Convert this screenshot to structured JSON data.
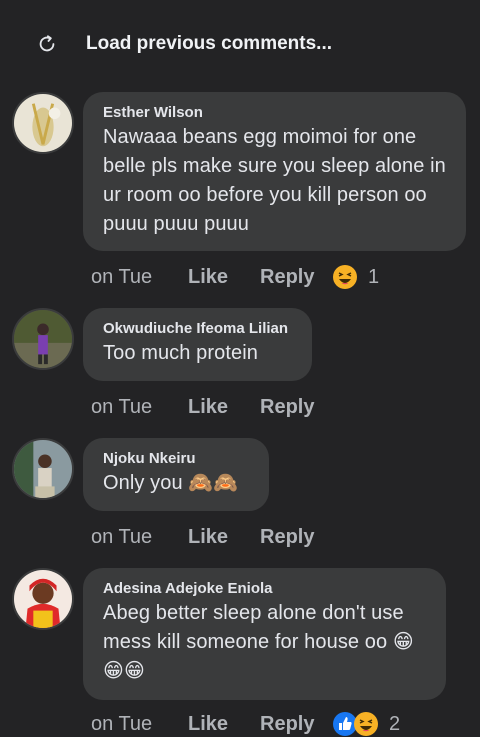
{
  "header": {
    "load_previous_label": "Load previous comments..."
  },
  "comments": [
    {
      "author": "Esther Wilson",
      "text": "Nawaaa beans egg moimoi for one belle pls make sure you sleep alone in ur room oo before you kill person oo puuu puuu puuu",
      "time": "on Tue",
      "like_label": "Like",
      "reply_label": "Reply",
      "reaction_count": "1",
      "reactions": [
        "haha-icon"
      ]
    },
    {
      "author": "Okwudiuche Ifeoma Lilian",
      "text": "Too much protein",
      "time": "on Tue",
      "like_label": "Like",
      "reply_label": "Reply"
    },
    {
      "author": "Njoku Nkeiru",
      "text": "Only you 🙈🙈",
      "time": "on Tue",
      "like_label": "Like",
      "reply_label": "Reply"
    },
    {
      "author": "Adesina Adejoke Eniola",
      "text": "Abeg better sleep alone don't use mess kill someone for house oo 😁😁😁",
      "time": "on Tue",
      "like_label": "Like",
      "reply_label": "Reply",
      "reaction_count": "2",
      "reactions": [
        "like-icon",
        "haha-icon"
      ]
    }
  ],
  "colors": {
    "background": "#232325",
    "bubble": "#3a3b3c",
    "meta_text": "#b0b3b8",
    "like_blue": "#1877f2",
    "haha_yellow": "#f7b125"
  }
}
